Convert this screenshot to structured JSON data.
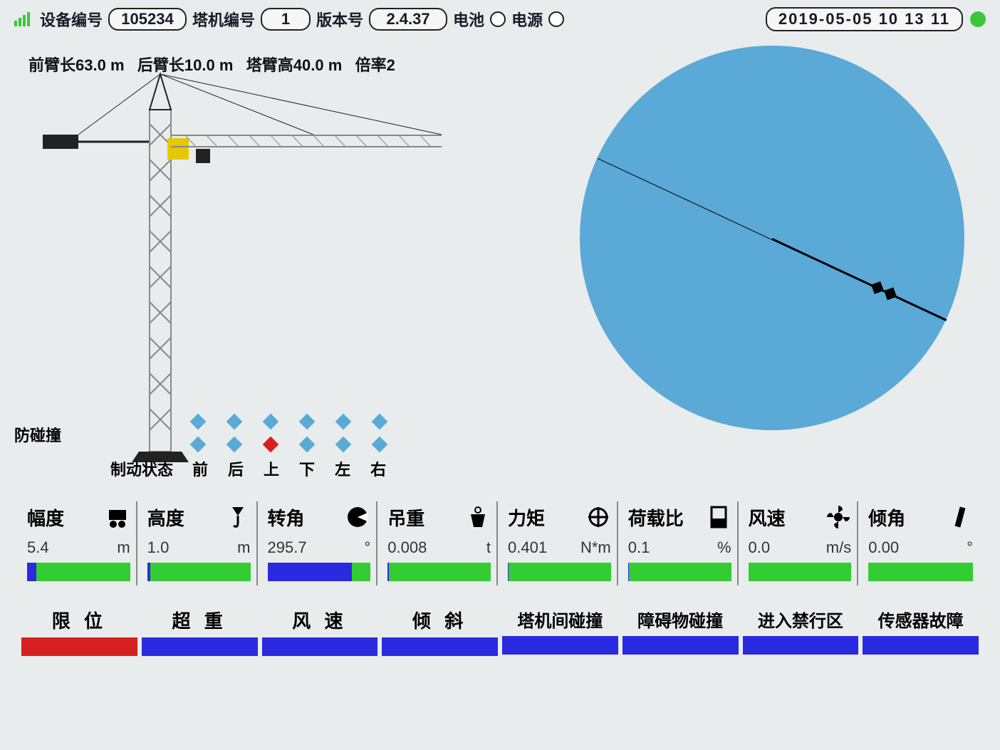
{
  "header": {
    "device_id_label": "设备编号",
    "device_id": "105234",
    "crane_id_label": "塔机编号",
    "crane_id": "1",
    "version_label": "版本号",
    "version": "2.4.37",
    "battery_label": "电池",
    "power_label": "电源",
    "datetime": "2019-05-05 10 13 11"
  },
  "params": {
    "front_arm_label": "前臂长",
    "front_arm": "63.0",
    "rear_arm_label": "后臂长",
    "rear_arm": "10.0",
    "height_label": "塔臂高",
    "height": "40.0",
    "unit": "m",
    "ratio_label": "倍率",
    "ratio": "2"
  },
  "collision_label": "防碰撞",
  "brake": {
    "title": "制动状态",
    "directions": [
      "前",
      "后",
      "上",
      "下",
      "左",
      "右"
    ],
    "row1": [
      false,
      false,
      false,
      false,
      false,
      false
    ],
    "row2": [
      false,
      false,
      true,
      false,
      false,
      false
    ]
  },
  "radar": {
    "angle_deg": 25
  },
  "metrics": [
    {
      "label": "幅度",
      "icon": "trolley-icon",
      "value": "5.4",
      "unit": "m",
      "fill": 9
    },
    {
      "label": "高度",
      "icon": "hook-icon",
      "value": "1.0",
      "unit": "m",
      "fill": 3
    },
    {
      "label": "转角",
      "icon": "angle-icon",
      "value": "295.7",
      "unit": "°",
      "fill": 82
    },
    {
      "label": "吊重",
      "icon": "weight-icon",
      "value": "0.008",
      "unit": "t",
      "fill": 1
    },
    {
      "label": "力矩",
      "icon": "moment-icon",
      "value": "0.401",
      "unit": "N*m",
      "fill": 1
    },
    {
      "label": "荷载比",
      "icon": "load-icon",
      "value": "0.1",
      "unit": "%",
      "fill": 1
    },
    {
      "label": "风速",
      "icon": "wind-icon",
      "value": "0.0",
      "unit": "m/s",
      "fill": 0
    },
    {
      "label": "倾角",
      "icon": "tilt-icon",
      "value": "0.00",
      "unit": "°",
      "fill": 0
    }
  ],
  "alarms": [
    {
      "label": "限 位",
      "active": true,
      "tight": false
    },
    {
      "label": "超 重",
      "active": false,
      "tight": false
    },
    {
      "label": "风 速",
      "active": false,
      "tight": false
    },
    {
      "label": "倾 斜",
      "active": false,
      "tight": false
    },
    {
      "label": "塔机间碰撞",
      "active": false,
      "tight": true
    },
    {
      "label": "障碍物碰撞",
      "active": false,
      "tight": true
    },
    {
      "label": "进入禁行区",
      "active": false,
      "tight": true
    },
    {
      "label": "传感器故障",
      "active": false,
      "tight": true
    }
  ]
}
